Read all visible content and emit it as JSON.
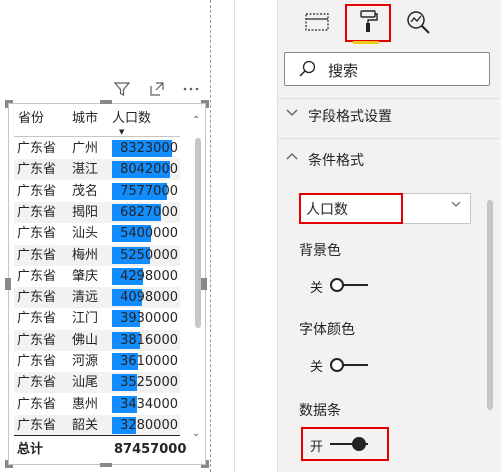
{
  "table": {
    "headers": [
      "省份",
      "城市",
      "人口数"
    ],
    "rows": [
      {
        "province": "广东省",
        "city": "广州",
        "pop": "8323000",
        "value": 8323000
      },
      {
        "province": "广东省",
        "city": "湛江",
        "pop": "8042000",
        "value": 8042000
      },
      {
        "province": "广东省",
        "city": "茂名",
        "pop": "7577000",
        "value": 7577000
      },
      {
        "province": "广东省",
        "city": "揭阳",
        "pop": "6827000",
        "value": 6827000
      },
      {
        "province": "广东省",
        "city": "汕头",
        "pop": "5400000",
        "value": 5400000
      },
      {
        "province": "广东省",
        "city": "梅州",
        "pop": "5250000",
        "value": 5250000
      },
      {
        "province": "广东省",
        "city": "肇庆",
        "pop": "4298000",
        "value": 4298000
      },
      {
        "province": "广东省",
        "city": "清远",
        "pop": "4098000",
        "value": 4098000
      },
      {
        "province": "广东省",
        "city": "江门",
        "pop": "3930000",
        "value": 3930000
      },
      {
        "province": "广东省",
        "city": "佛山",
        "pop": "3816000",
        "value": 3816000
      },
      {
        "province": "广东省",
        "city": "河源",
        "pop": "3610000",
        "value": 3610000
      },
      {
        "province": "广东省",
        "city": "汕尾",
        "pop": "3525000",
        "value": 3525000
      },
      {
        "province": "广东省",
        "city": "惠州",
        "pop": "3434000",
        "value": 3434000
      },
      {
        "province": "广东省",
        "city": "韶关",
        "pop": "3280000",
        "value": 3280000
      }
    ],
    "total_label": "总计",
    "total_value": "87457000",
    "bar_color": "#118dff"
  },
  "visual_header": {
    "icons": [
      "filter-icon",
      "focus-mode-icon",
      "more-options-icon"
    ]
  },
  "pane": {
    "search_label": "搜索",
    "section_field_format": "字段格式设置",
    "section_conditional": "条件格式",
    "field_dropdown_value": "人口数",
    "background_color_label": "背景色",
    "background_color_state": "关",
    "font_color_label": "字体颜色",
    "font_color_state": "关",
    "data_bars_label": "数据条",
    "data_bars_state": "开",
    "highlight_color": "#e00000",
    "tab_accent": "#f2c811"
  }
}
